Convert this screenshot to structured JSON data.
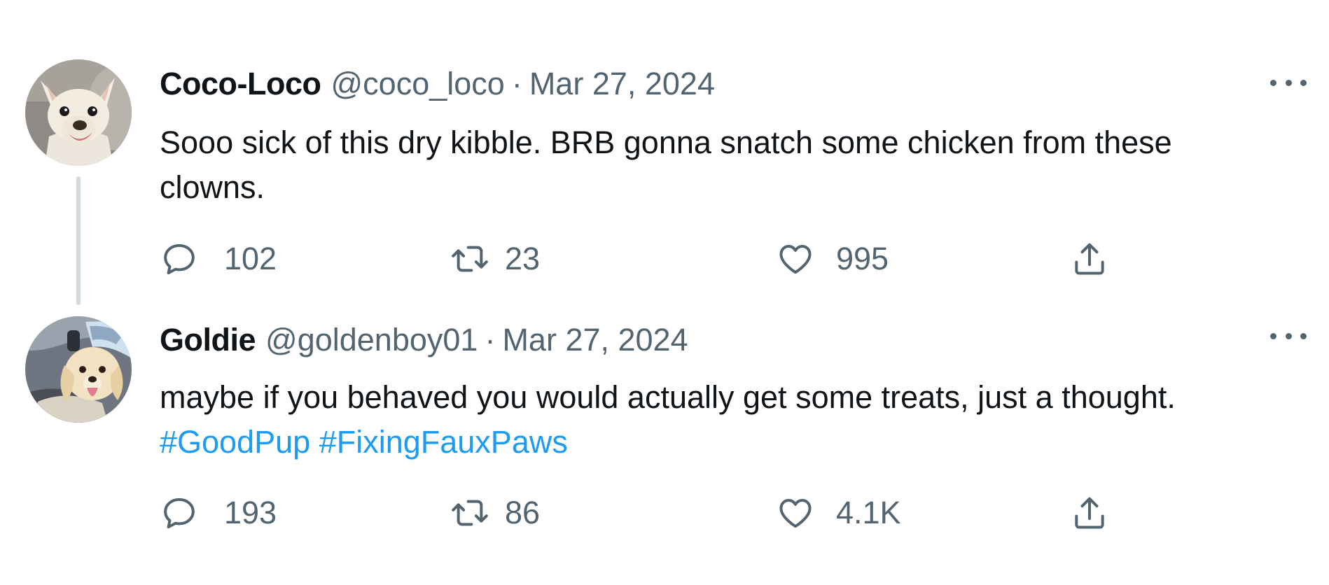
{
  "thread": {
    "tweets": [
      {
        "author": {
          "display_name": "Coco-Loco",
          "handle": "@coco_loco",
          "avatar": "chihuahua-avatar"
        },
        "separator": "·",
        "date": "Mar 27, 2024",
        "text_lines": [
          "Sooo sick of this dry kibble. BRB gonna snatch some chicken from these",
          "clowns."
        ],
        "hashtags": [],
        "stats": {
          "replies": "102",
          "retweets": "23",
          "likes": "995"
        }
      },
      {
        "author": {
          "display_name": "Goldie",
          "handle": "@goldenboy01",
          "avatar": "golden-puppy-avatar"
        },
        "separator": "·",
        "date": "Mar 27, 2024",
        "text_lines": [
          "maybe if you behaved you would actually get some treats, just a thought."
        ],
        "hashtags": [
          "#GoodPup",
          "#FixingFauxPaws"
        ],
        "stats": {
          "replies": "193",
          "retweets": "86",
          "likes": "4.1K"
        }
      }
    ]
  },
  "icons": {
    "reply": "reply-icon",
    "retweet": "retweet-icon",
    "like": "heart-icon",
    "share": "share-icon",
    "more": "more-icon"
  },
  "colors": {
    "text_primary": "#0f1419",
    "text_secondary": "#536471",
    "link": "#1d9bf0",
    "thread_line": "#cfd9de"
  }
}
